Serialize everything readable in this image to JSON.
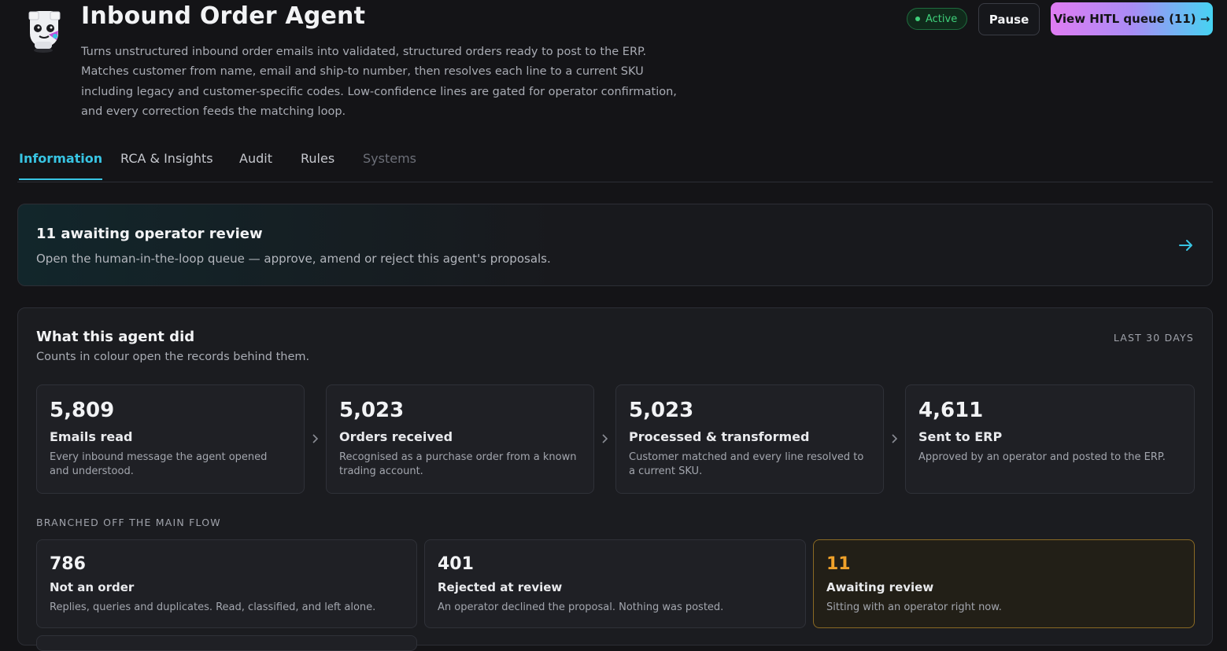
{
  "agent": {
    "title": "Inbound Order Agent",
    "description": "Turns unstructured inbound order emails into validated, structured orders ready to post to the ERP. Matches customer from name, email and ship-to number, then resolves each line to a current SKU including legacy and customer-specific codes. Low-confidence lines are gated for operator confirmation, and every correction feeds the matching loop.",
    "avatar_icon": "robot-mascot-icon"
  },
  "header_actions": {
    "status_label": "Active",
    "status_color": "#3fd07a",
    "pause_label": "Pause",
    "hitl_label": "View HITL queue (11) →"
  },
  "tabs": [
    {
      "label": "Information",
      "active": true
    },
    {
      "label": "RCA & Insights",
      "active": false
    },
    {
      "label": "Audit",
      "active": false
    },
    {
      "label": "Rules",
      "active": false
    },
    {
      "label": "Systems",
      "active": false,
      "disabled": true
    }
  ],
  "hitl_banner": {
    "title": "11 awaiting operator review",
    "subtitle": "Open the human-in-the-loop queue — approve, amend or reject this agent's proposals.",
    "icon": "arrow-right-icon"
  },
  "activity": {
    "title": "What this agent did",
    "subtitle": "Counts in colour open the records behind them.",
    "period": "LAST 30 DAYS",
    "flow": [
      {
        "value": "5,809",
        "label": "Emails read",
        "text": "Every inbound message the agent opened and understood."
      },
      {
        "value": "5,023",
        "label": "Orders received",
        "text": "Recognised as a purchase order from a known trading account."
      },
      {
        "value": "5,023",
        "label": "Processed & transformed",
        "text": "Customer matched and every line resolved to a current SKU."
      },
      {
        "value": "4,611",
        "label": "Sent to ERP",
        "text": "Approved by an operator and posted to the ERP."
      }
    ],
    "branch_heading": "BRANCHED OFF THE MAIN FLOW",
    "branches": [
      {
        "value": "786",
        "label": "Not an order",
        "text": "Replies, queries and duplicates. Read, classified, and left alone."
      },
      {
        "value": "401",
        "label": "Rejected at review",
        "text": "An operator declined the proposal. Nothing was posted."
      },
      {
        "value": "11",
        "label": "Awaiting review",
        "text": "Sitting with an operator right now.",
        "accent": "#f0a22a"
      }
    ]
  }
}
